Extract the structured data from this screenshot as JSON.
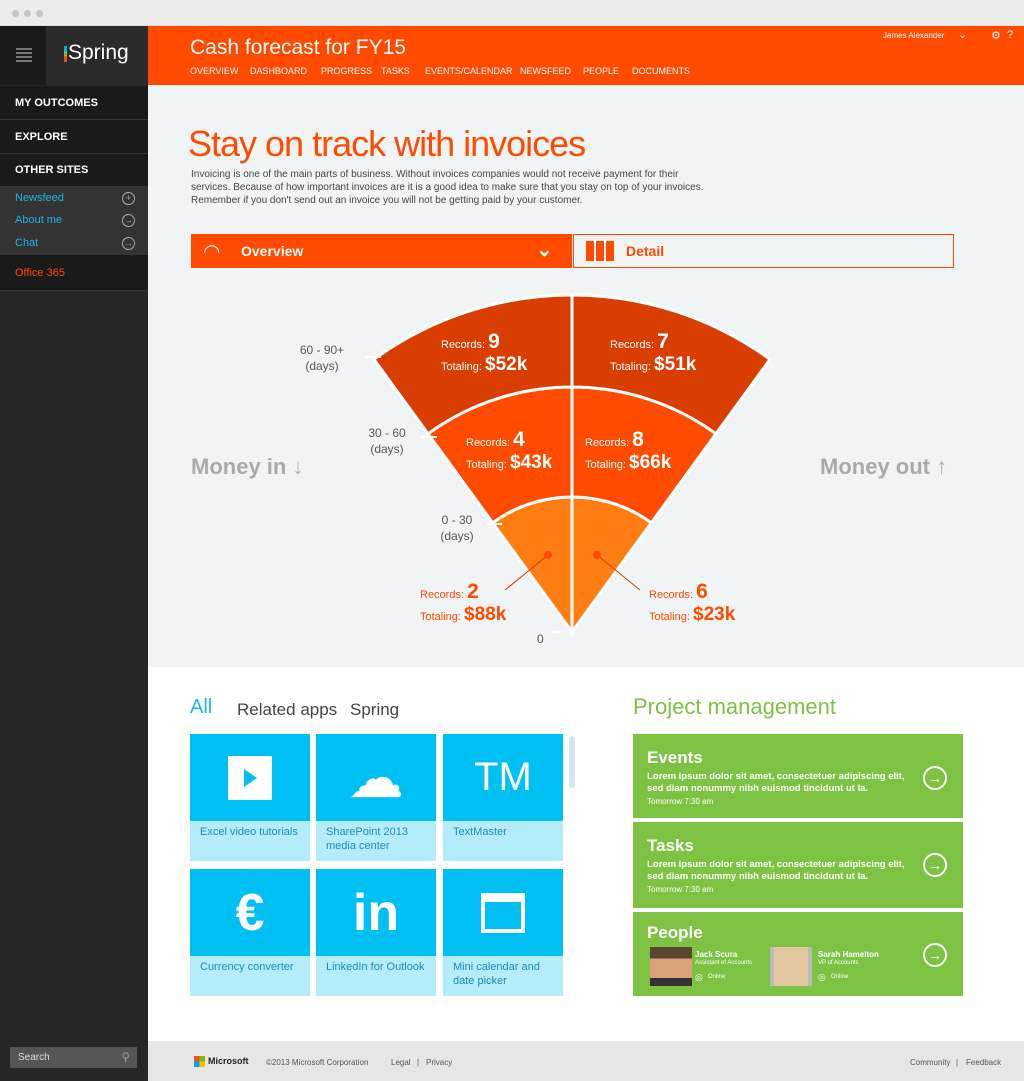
{
  "app": {
    "logo": "Spring",
    "title": "Cash forecast for FY15",
    "user": "James Alexander"
  },
  "nav": [
    "OVERVIEW",
    "DASHBOARD",
    "PROGRESS",
    "TASKS",
    "EVENTS/CALENDAR",
    "NEWSFEED",
    "PEOPLE",
    "DOCUMENTS"
  ],
  "sidebar": {
    "items": [
      "MY OUTCOMES",
      "EXPLORE",
      "OTHER SITES"
    ],
    "sites": [
      "Newsfeed",
      "About me",
      "Chat"
    ],
    "office": "Office 365",
    "search_placeholder": "Search"
  },
  "hero": {
    "heading": "Stay on track with invoices",
    "body": "Invoicing is one of the main parts of business. Without invoices companies would not receive payment for their services. Because of how important invoices are it is a good idea to make sure that you stay on top of your invoices. Remember if you don't send out an invoice you will not be getting paid by your customer."
  },
  "toggle": {
    "overview": "Overview",
    "detail": "Detail"
  },
  "fan": {
    "money_in": "Money in ↓",
    "money_out": "Money out ↑",
    "rings": [
      "0 - 30\n(days)",
      "30 - 60\n(days)",
      "60 - 90+\n(days)"
    ],
    "zero": "0",
    "records_label": "Records:",
    "totaling_label": "Totaling:",
    "colors": [
      "#ff7d12",
      "#ff4b00",
      "#da3d00"
    ],
    "in": [
      {
        "records": "2",
        "total": "$88k"
      },
      {
        "records": "4",
        "total": "$43k"
      },
      {
        "records": "9",
        "total": "$52k"
      }
    ],
    "out": [
      {
        "records": "6",
        "total": "$23k"
      },
      {
        "records": "8",
        "total": "$66k"
      },
      {
        "records": "7",
        "total": "$51k"
      }
    ]
  },
  "apps": {
    "tabs": [
      "All",
      "Related apps",
      "Spring"
    ],
    "tiles": [
      {
        "icon": "play-icon",
        "label": "Excel video tutorials"
      },
      {
        "icon": "cloud-play-icon",
        "label": "SharePoint 2013 media center"
      },
      {
        "icon": "TM",
        "label": "TextMaster"
      },
      {
        "icon": "€",
        "label": "Currency converter"
      },
      {
        "icon": "in",
        "label": "LinkedIn for Outlook"
      },
      {
        "icon": "calendar-icon",
        "label": "Mini calendar and date picker"
      }
    ]
  },
  "pm": {
    "title": "Project management",
    "events": {
      "title": "Events",
      "text": "Lorem ipsum dolor sit amet, consectetuer adipiscing elit, sed diam nonummy nibh euismod tincidunt ut la.",
      "time": "Tomorrow 7:30 am"
    },
    "tasks": {
      "title": "Tasks",
      "text": "Lorem ipsum dolor sit amet, consectetuer adipiscing elit, sed diam nonummy nibh euismod tincidunt ut la.",
      "time": "Tomorrow 7:30 am"
    },
    "people": {
      "title": "People",
      "list": [
        {
          "name": "Jack Scura",
          "role": "Assistant of Accounts",
          "status": "Online"
        },
        {
          "name": "Sarah Hamelton",
          "role": "VP of Accounts",
          "status": "Online"
        }
      ]
    }
  },
  "footer": {
    "brand": "Microsoft",
    "copyright": "©2013 Microsoft Corporation",
    "legal": "Legal",
    "privacy": "Privacy",
    "community": "Community",
    "feedback": "Feedback"
  }
}
